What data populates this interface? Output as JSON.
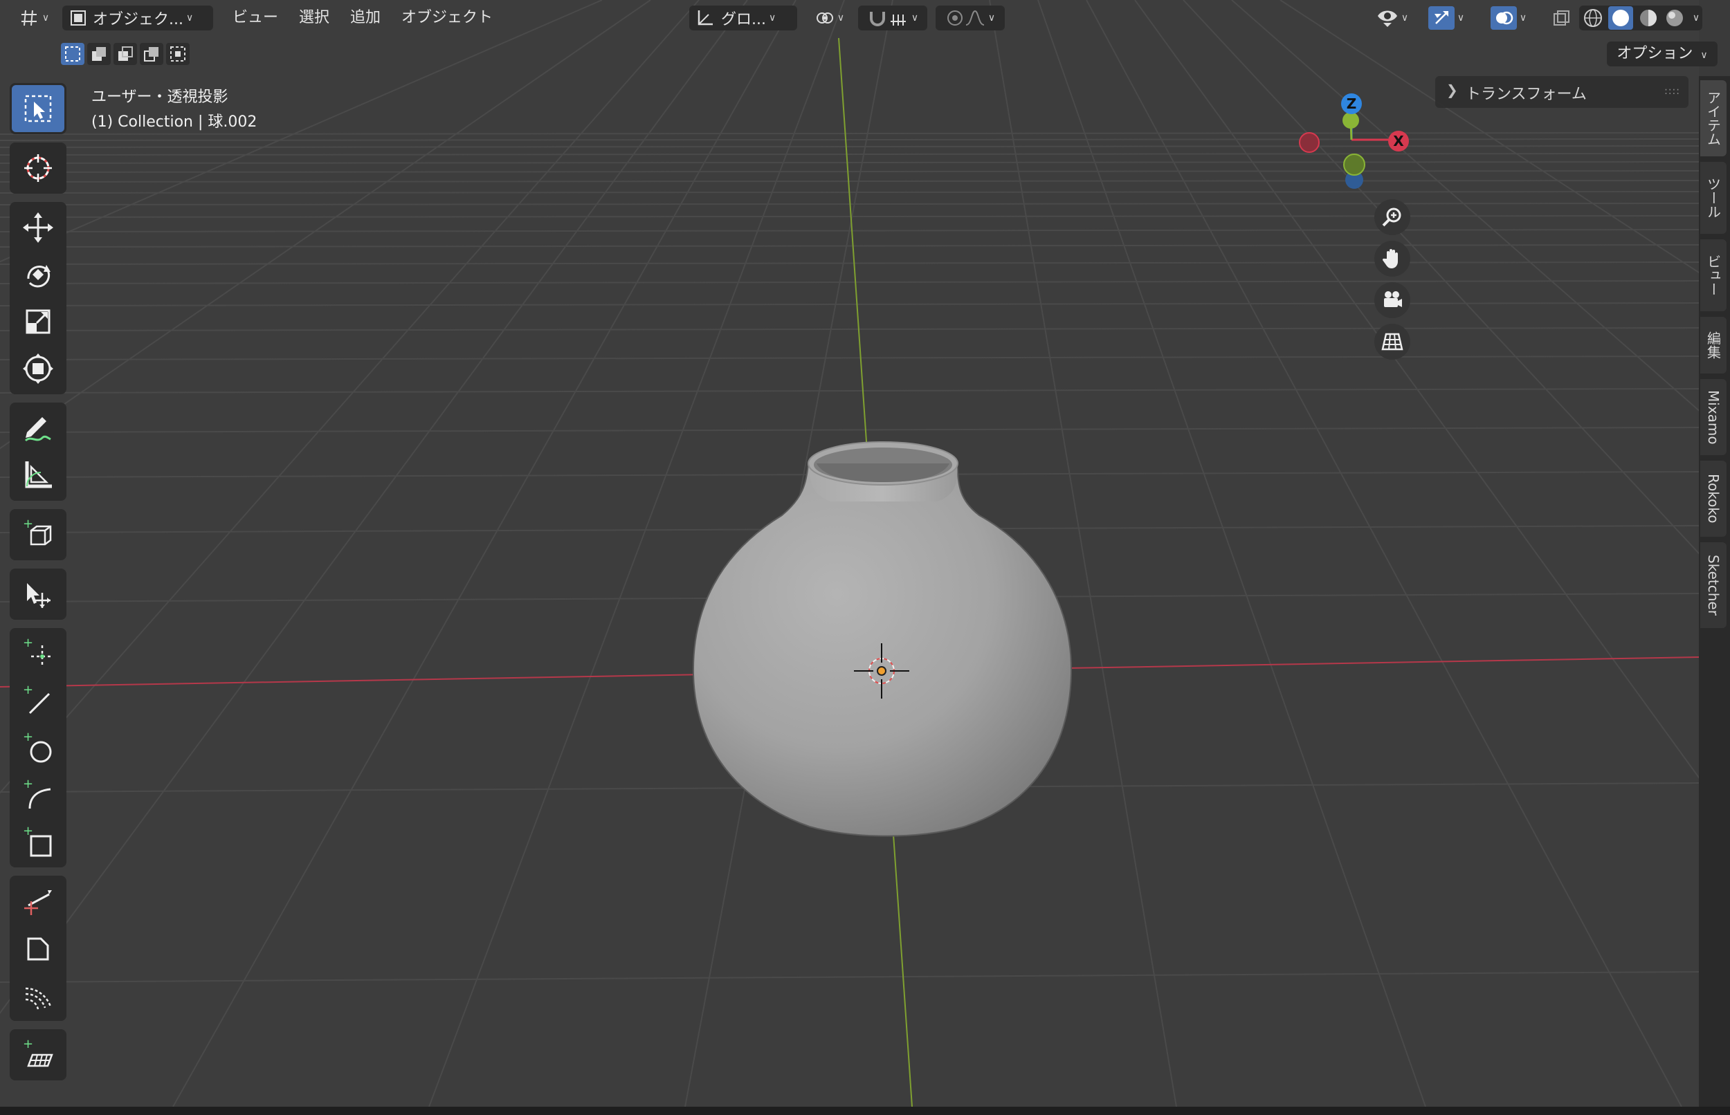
{
  "header": {
    "mode_label": "オブジェク...",
    "menus": [
      "ビュー",
      "選択",
      "追加",
      "オブジェクト"
    ],
    "transform_orientation": "グロ...",
    "options_label": "オプション"
  },
  "viewport": {
    "view_title": "ユーザー・透視投影",
    "view_subtitle": "(1) Collection | 球.002"
  },
  "npanel": {
    "transform_label": "トランスフォーム"
  },
  "side_tabs": [
    "アイテム",
    "ツール",
    "ビュー",
    "編集",
    "Mixamo",
    "Rokoko",
    "Sketcher"
  ],
  "gizmo": {
    "z_label": "Z",
    "x_label": "X"
  },
  "colors": {
    "accent": "#4772b3",
    "axis_x": "#d6394f",
    "axis_y": "#8ab536",
    "axis_z": "#2f86e0",
    "add_tool_plus": "#6ee08a"
  },
  "icons": {
    "toolbar": [
      "select-box-icon",
      "cursor-icon",
      "move-icon",
      "rotate-icon",
      "scale-icon",
      "transform-icon",
      "annotate-icon",
      "measure-icon",
      "add-cube-icon",
      "select-move-icon",
      "add-point-icon",
      "add-line-icon",
      "add-circle-icon",
      "add-arc-icon",
      "add-rect-icon",
      "knife-icon",
      "bevel-icon",
      "curve-tool-icon",
      "add-grid-icon"
    ]
  }
}
